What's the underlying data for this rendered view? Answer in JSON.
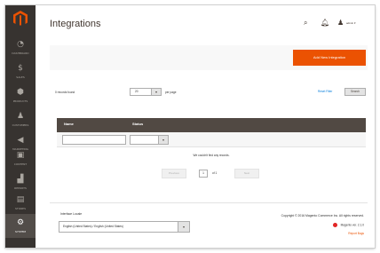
{
  "header": {
    "title": "Integrations",
    "user_name": "admin"
  },
  "sidebar": {
    "items": [
      {
        "label": "DASHBOARD",
        "icon": "dashboard-icon"
      },
      {
        "label": "SALES",
        "icon": "dollar-icon"
      },
      {
        "label": "PRODUCTS",
        "icon": "cube-icon"
      },
      {
        "label": "CUSTOMERS",
        "icon": "person-icon"
      },
      {
        "label": "MARKETING",
        "icon": "megaphone-icon"
      },
      {
        "label": "CONTENT",
        "icon": "content-icon"
      },
      {
        "label": "REPORTS",
        "icon": "bar-chart-icon"
      },
      {
        "label": "STORES",
        "icon": "store-icon"
      },
      {
        "label": "SYSTEM",
        "icon": "gear-icon"
      }
    ]
  },
  "actions": {
    "add_button": "Add New Integration"
  },
  "grid": {
    "records_found": "0 records found",
    "per_page_value": "20",
    "per_page_label": "per page",
    "reset_filter": "Reset Filter",
    "search_button": "Search",
    "columns": [
      "Name",
      "Status"
    ],
    "empty_message": "We couldn't find any records.",
    "prev_label": "Previous",
    "next_label": "Next",
    "current_page": "1",
    "page_of": "of 1"
  },
  "footer": {
    "scope_label": "Interface Locale",
    "scope_value": "English (United States) / English (United States)",
    "copyright": "Copyright © 2016 Magento Commerce Inc. All rights reserved.",
    "version": "Magento ver. 2.1.0",
    "report_bugs": "Report Bugs"
  },
  "colors": {
    "accent": "#eb5202",
    "sidebar": "#373330",
    "grid_header": "#514943"
  }
}
